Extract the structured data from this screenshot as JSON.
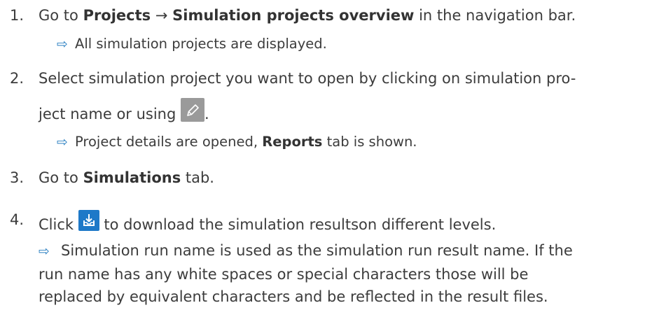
{
  "steps": [
    {
      "number": "1.",
      "text_before": "Go to ",
      "bold1": "Projects",
      "arrow": "→",
      "bold2": "Simulation projects overview",
      "text_after": " in the navigation bar.",
      "result": "All simulation projects are displayed."
    },
    {
      "number": "2.",
      "line1": "Select simulation project you want to open by clicking on simulation pro-",
      "line2_before": "ject name or using ",
      "line2_after": ".",
      "result_before": "Project details are opened, ",
      "result_bold": "Reports",
      "result_after": " tab is shown."
    },
    {
      "number": "3.",
      "text_before": "Go to ",
      "bold": "Simulations",
      "text_after": " tab."
    },
    {
      "number": "4.",
      "text_before": "Click ",
      "text_after": " to download the simulation resultson different levels.",
      "result_line1": "Simulation run name is used as the simulation run result name. If the",
      "result_line2": "run name has any white spaces or special characters those will be",
      "result_line3": "replaced by equivalent characters and be reflected in the result files."
    }
  ],
  "result_arrow": "⇨",
  "icons": {
    "edit": "pencil-icon",
    "download": "download-icon"
  },
  "colors": {
    "text": "#3c3c3c",
    "arrow": "#2a7fc1",
    "edit_icon_bg": "#9a9a9a",
    "download_icon_bg": "#1e79c8"
  }
}
